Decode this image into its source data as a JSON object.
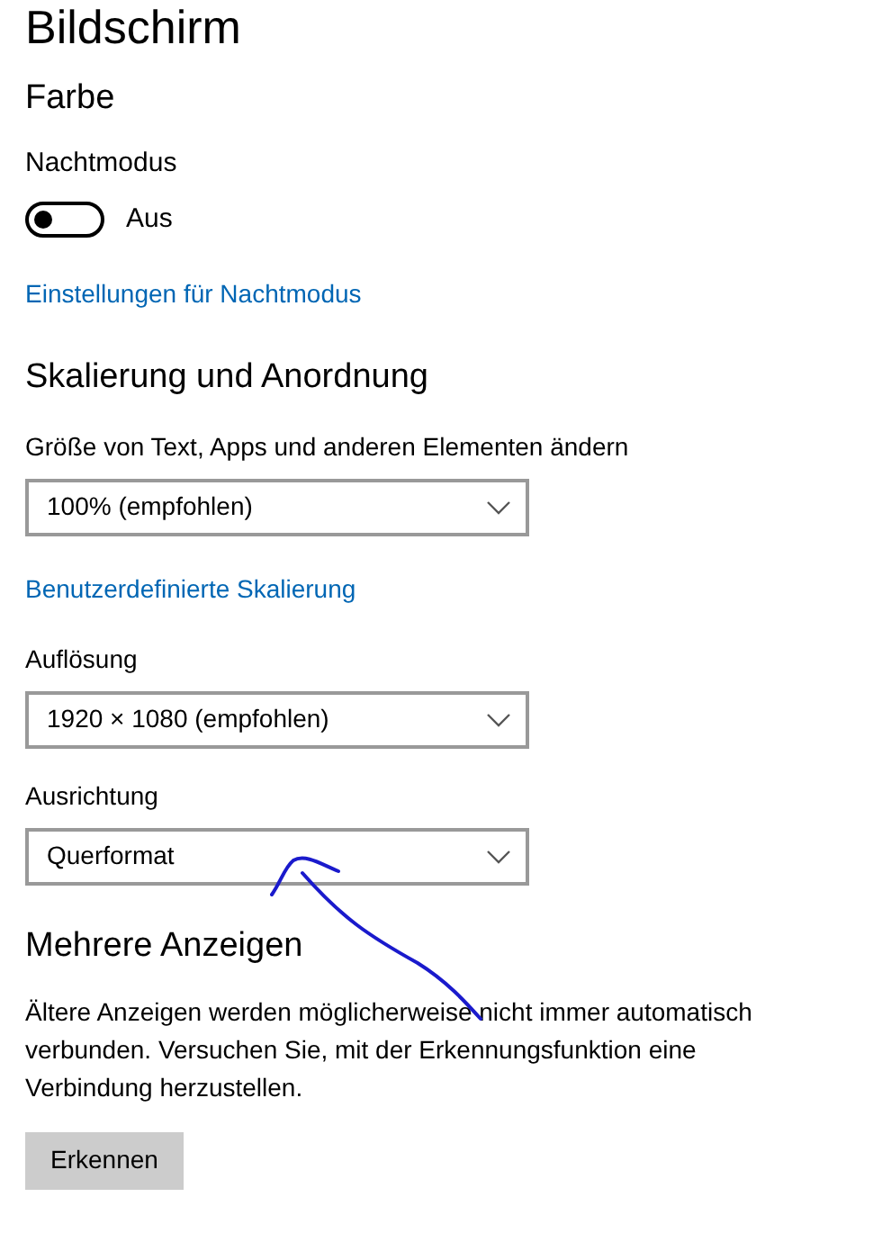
{
  "title": "Bildschirm",
  "sections": [
    {
      "heading": "Farbe",
      "items": [
        {
          "kind": "toggle",
          "label": "Nachtmodus",
          "on": false,
          "state_text": "Aus"
        },
        {
          "kind": "link",
          "text": "Einstellungen für Nachtmodus"
        }
      ]
    },
    {
      "heading": "Skalierung und Anordnung",
      "items": [
        {
          "kind": "dropdown",
          "label": "Größe von Text, Apps und anderen Elementen ändern",
          "value": "100% (empfohlen)"
        },
        {
          "kind": "link",
          "text": "Benutzerdefinierte Skalierung"
        },
        {
          "kind": "dropdown",
          "label": "Auflösung",
          "value": "1920 × 1080 (empfohlen)"
        },
        {
          "kind": "dropdown",
          "label": "Ausrichtung",
          "value": "Querformat"
        }
      ]
    },
    {
      "heading": "Mehrere Anzeigen",
      "items": [
        {
          "kind": "text",
          "text": "Ältere Anzeigen werden möglicherweise nicht immer automatisch verbunden. Versuchen Sie, mit der Erkennungsfunktion eine Verbindung herzustellen."
        },
        {
          "kind": "button",
          "text": "Erkennen"
        }
      ]
    }
  ]
}
